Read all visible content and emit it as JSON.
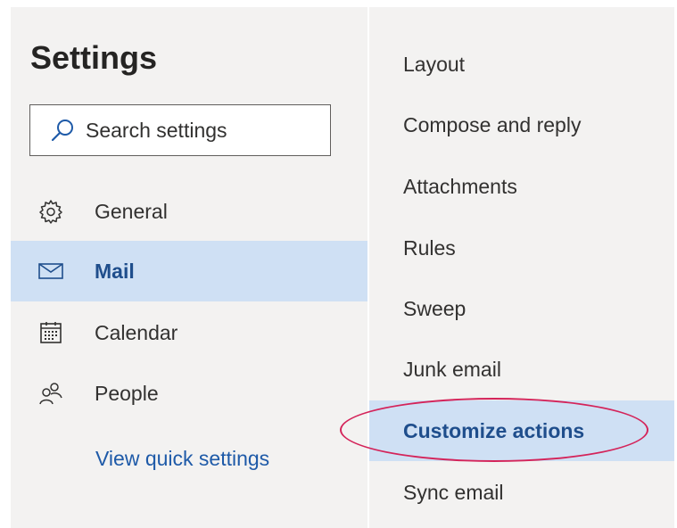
{
  "settings": {
    "title": "Settings",
    "search": {
      "placeholder": "Search settings"
    },
    "nav": [
      {
        "label": "General",
        "icon": "gear-icon"
      },
      {
        "label": "Mail",
        "icon": "mail-icon",
        "selected": true
      },
      {
        "label": "Calendar",
        "icon": "calendar-icon"
      },
      {
        "label": "People",
        "icon": "people-icon"
      }
    ],
    "quick_settings_link": "View quick settings"
  },
  "mail_settings": {
    "items": [
      {
        "label": "Layout"
      },
      {
        "label": "Compose and reply"
      },
      {
        "label": "Attachments"
      },
      {
        "label": "Rules"
      },
      {
        "label": "Sweep"
      },
      {
        "label": "Junk email"
      },
      {
        "label": "Customize actions",
        "selected": true,
        "annotated": true
      },
      {
        "label": "Sync email"
      }
    ]
  },
  "colors": {
    "panel_bg": "#f3f2f1",
    "selected_bg": "#cfe0f4",
    "selected_text": "#1f4e8c",
    "link": "#1e5aa8",
    "annotation": "#d4245a"
  }
}
